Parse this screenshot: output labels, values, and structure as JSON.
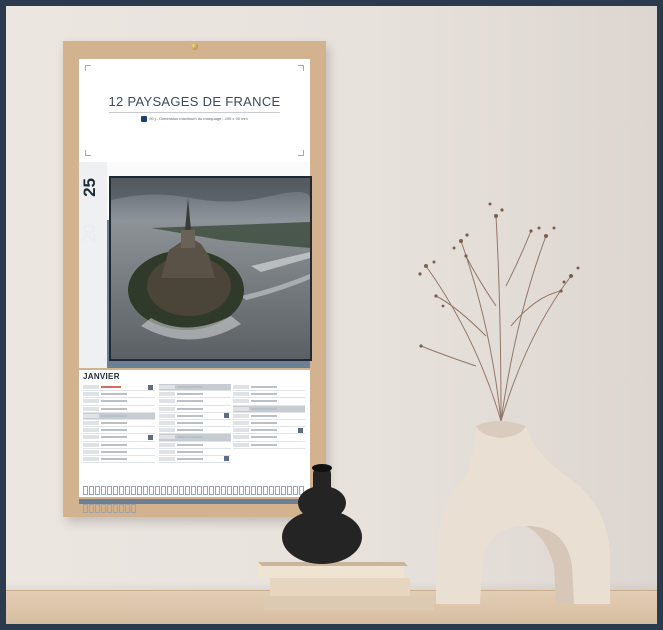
{
  "calendar": {
    "title": "12 PAYSAGES DE FRANCE",
    "subtitle": "90 j - Dimension maximum du marquage : 205 x 90 mm",
    "year_top": "25",
    "year_bottom": "20",
    "month": "JANVIER"
  },
  "colors": {
    "wall": "#e8e2dd",
    "frame": "#d3b28f",
    "slate": "#6c7f93",
    "shelf": "#d5bb9c"
  }
}
